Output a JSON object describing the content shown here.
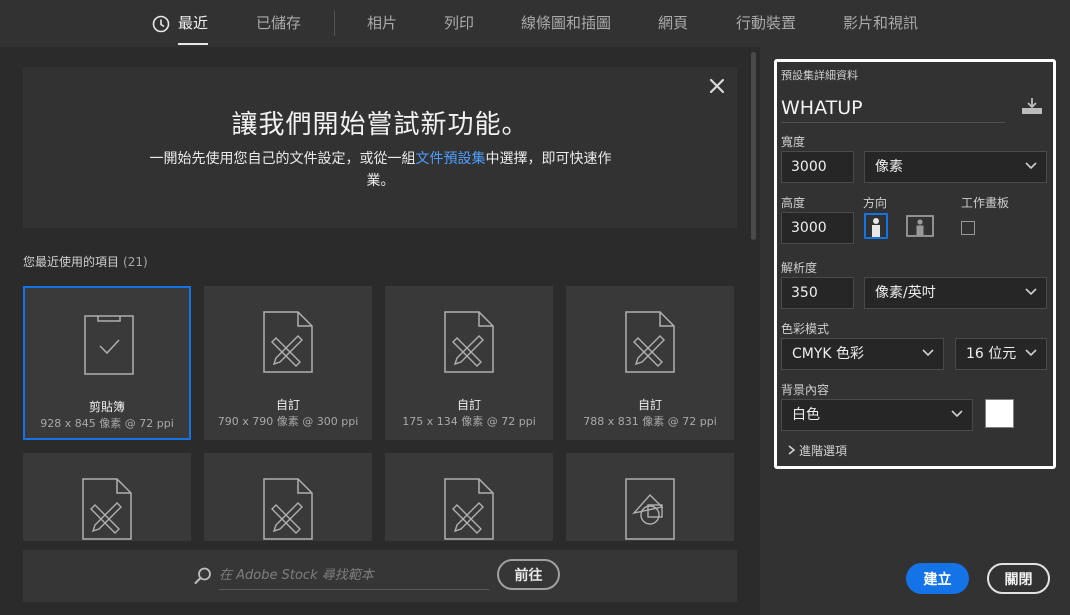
{
  "tabs": [
    {
      "label": "最近",
      "active": true,
      "icon": "clock-icon"
    },
    {
      "label": "已儲存"
    },
    {
      "label": "相片"
    },
    {
      "label": "列印"
    },
    {
      "label": "線條圖和插圖"
    },
    {
      "label": "網頁"
    },
    {
      "label": "行動裝置"
    },
    {
      "label": "影片和視訊"
    }
  ],
  "welcome": {
    "title": "讓我們開始嘗試新功能。",
    "desc_before": "一開始先使用您自己的文件設定，或從一組",
    "desc_link": "文件預設集",
    "desc_after": "中選擇，即可快速作業。",
    "close_icon": "close-icon"
  },
  "recent": {
    "heading": "您最近使用的項目",
    "count": "(21)",
    "items": [
      {
        "name": "剪貼簿",
        "meta": "928 x 845 像素 @ 72 ppi",
        "icon": "clipboard-icon",
        "selected": true
      },
      {
        "name": "自訂",
        "meta": "790 x 790 像素 @ 300 ppi",
        "icon": "custom-document-icon"
      },
      {
        "name": "自訂",
        "meta": "175 x 134 像素 @ 72 ppi",
        "icon": "custom-document-icon"
      },
      {
        "name": "自訂",
        "meta": "788 x 831 像素 @ 72 ppi",
        "icon": "custom-document-icon"
      },
      {
        "name": "",
        "meta": "",
        "icon": "custom-document-icon"
      },
      {
        "name": "",
        "meta": "",
        "icon": "custom-document-icon"
      },
      {
        "name": "",
        "meta": "",
        "icon": "custom-document-icon"
      },
      {
        "name": "",
        "meta": "",
        "icon": "shapes-document-icon"
      }
    ]
  },
  "stock": {
    "placeholder": "在 Adobe Stock 尋找範本",
    "go_label": "前往"
  },
  "details": {
    "heading": "預設集詳細資料",
    "preset_name": "WHATUP",
    "width_label": "寬度",
    "width_value": "3000",
    "width_unit": "像素",
    "height_label": "高度",
    "height_value": "3000",
    "orientation_label": "方向",
    "orientation": "portrait",
    "artboard_label": "工作畫板",
    "artboard_checked": false,
    "resolution_label": "解析度",
    "resolution_value": "350",
    "resolution_unit": "像素/英吋",
    "color_mode_label": "色彩模式",
    "color_mode": "CMYK 色彩",
    "bit_depth": "16 位元",
    "background_label": "背景內容",
    "background": "白色",
    "background_color": "#ffffff",
    "advanced_label": "進階選項"
  },
  "actions": {
    "create_label": "建立",
    "close_label": "關閉"
  },
  "colors": {
    "accent": "#1473e6",
    "link": "#4d9dff"
  }
}
